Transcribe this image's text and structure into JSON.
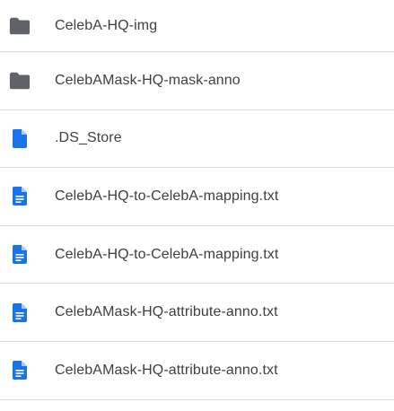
{
  "colors": {
    "folder_icon": "#5f6368",
    "file_icon": "#1a73e8",
    "text": "#3c4043",
    "divider": "#dadce0"
  },
  "files": [
    {
      "name": "CelebA-HQ-img",
      "icon": "folder-icon",
      "type": "folder"
    },
    {
      "name": "CelebAMask-HQ-mask-anno",
      "icon": "folder-icon",
      "type": "folder"
    },
    {
      "name": ".DS_Store",
      "icon": "file-icon",
      "type": "file"
    },
    {
      "name": "CelebA-HQ-to-CelebA-mapping.txt",
      "icon": "text-document-icon",
      "type": "text"
    },
    {
      "name": "CelebA-HQ-to-CelebA-mapping.txt",
      "icon": "text-document-icon",
      "type": "text"
    },
    {
      "name": "CelebAMask-HQ-attribute-anno.txt",
      "icon": "text-document-icon",
      "type": "text"
    },
    {
      "name": "CelebAMask-HQ-attribute-anno.txt",
      "icon": "text-document-icon",
      "type": "text"
    }
  ]
}
